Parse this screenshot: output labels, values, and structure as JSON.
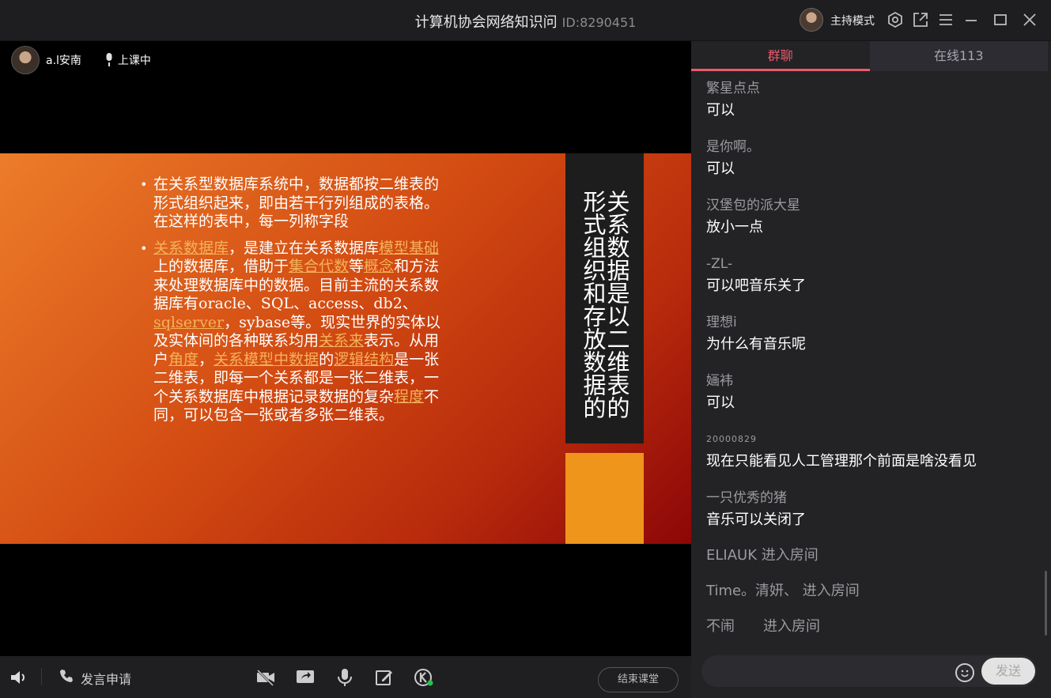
{
  "window": {
    "title": "计算机协会网络知识问",
    "room_id": "ID:8290451",
    "host_mode_label": "主持模式",
    "icons": [
      "settings-icon",
      "popout-icon",
      "menu-icon",
      "minimize-icon",
      "maximize-icon",
      "close-icon"
    ]
  },
  "presenter": {
    "name": "a.l安南",
    "status": "上课中"
  },
  "slide": {
    "bullets": [
      {
        "parts": [
          {
            "t": "在关系型数据库系统中，数据都按二维表的形式组织起来，即由若干行列组成的表格。在这样的表中，每一列称字段",
            "link": false
          }
        ]
      },
      {
        "parts": [
          {
            "t": "关系数据库",
            "link": true
          },
          {
            "t": "，是建立在关系数据库",
            "link": false
          },
          {
            "t": "模型基础",
            "link": true
          },
          {
            "t": "上的数据库，借助于",
            "link": false
          },
          {
            "t": "集合代数",
            "link": true
          },
          {
            "t": "等",
            "link": false
          },
          {
            "t": "概念",
            "link": true
          },
          {
            "t": "和方法来处理数据库中的数据。目前主流的关系数据库有oracle、SQL、access、db2、",
            "link": false
          },
          {
            "t": "sqlserver",
            "link": true
          },
          {
            "t": "，sybase等。现实世界的实体以及实体间的各种联系均用",
            "link": false
          },
          {
            "t": "关系来",
            "link": true
          },
          {
            "t": "表示。从用户",
            "link": false
          },
          {
            "t": "角度",
            "link": true
          },
          {
            "t": "，",
            "link": false
          },
          {
            "t": "关系模型中数据",
            "link": true
          },
          {
            "t": "的",
            "link": false
          },
          {
            "t": "逻辑结构",
            "link": true
          },
          {
            "t": "是一张二维表，即每一个关系都是一张二维表，一个关系数据库中根据记录数据的复杂",
            "link": false
          },
          {
            "t": "程度",
            "link": true
          },
          {
            "t": "不同，可以包含一张或者多张二维表。",
            "link": false
          }
        ]
      }
    ],
    "side_text": "关系数据是以二维表的形式组织和存放数据的"
  },
  "toolbar": {
    "apply_label": "发言申请",
    "end_label": "结束课堂",
    "icons": [
      "speaker-icon",
      "camera-off-icon",
      "screen-share-icon",
      "microphone-icon",
      "edit-icon",
      "k-app-icon"
    ]
  },
  "chat": {
    "tabs": [
      {
        "label": "群聊",
        "active": true
      },
      {
        "label": "在线113",
        "active": false
      }
    ],
    "messages": [
      {
        "who": "繁星点点",
        "text": "可以"
      },
      {
        "who": "是你啊。",
        "text": "可以"
      },
      {
        "who": "汉堡包的派大星",
        "text": "放小一点"
      },
      {
        "who": "-ZL-",
        "text": "可以吧音乐关了"
      },
      {
        "who": "理想i",
        "text": "为什么有音乐呢"
      },
      {
        "who": "婳袆",
        "text": "可以"
      },
      {
        "who": "20000829",
        "text": "现在只能看见人工管理那个前面是啥没看见"
      },
      {
        "who": "一只优秀的猪",
        "text": "音乐可以关闭了"
      }
    ],
    "system": [
      "ELIAUK 进入房间",
      "Time。清妍、 进入房间",
      "不闹　　进入房间"
    ],
    "send_label": "发送"
  }
}
